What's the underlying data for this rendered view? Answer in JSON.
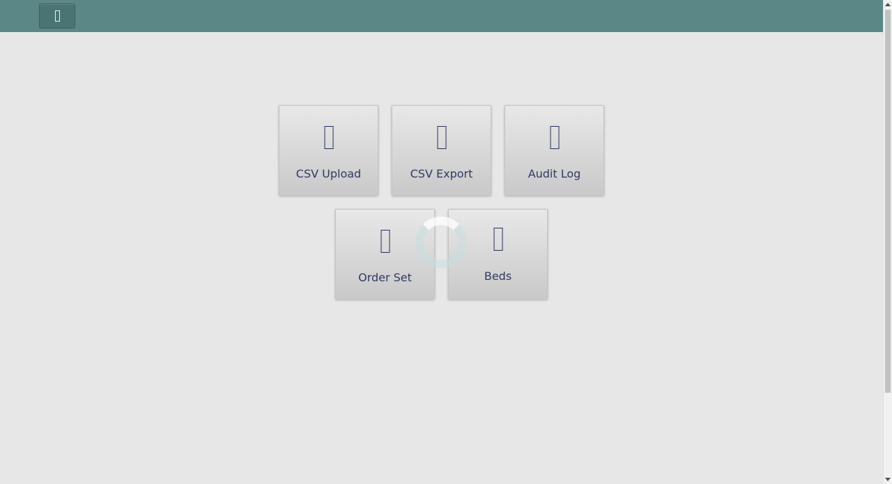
{
  "header": {
    "menu_button_icon": "menu-icon"
  },
  "tiles": [
    {
      "label": "CSV Upload",
      "icon": "upload-icon"
    },
    {
      "label": "CSV Export",
      "icon": "export-icon"
    },
    {
      "label": "Audit Log",
      "icon": "audit-log-icon"
    },
    {
      "label": "Order Set",
      "icon": "order-set-icon"
    },
    {
      "label": "Beds",
      "icon": "bed-icon"
    }
  ],
  "colors": {
    "header_background": "#5c8787",
    "page_background": "#e7e7e7",
    "tile_text": "#2f3a62"
  }
}
